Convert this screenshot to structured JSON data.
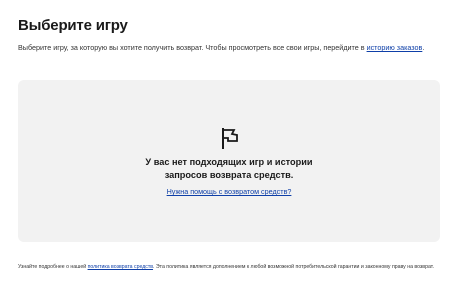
{
  "header": {
    "title": "Выберите игру"
  },
  "intro": {
    "text_before": "Выберите игру, за которую вы хотите получить возврат. Чтобы просмотреть все свои игры, перейдите в ",
    "link_text": "историю заказов",
    "text_after": "."
  },
  "empty_state": {
    "icon": "flag-icon",
    "line1": "У вас нет подходящих игр и истории",
    "line2": "запросов возврата средств.",
    "help_link": "Нужна помощь с возвратом средств?"
  },
  "footer": {
    "text_before": "Узнайте подробнее о нашей ",
    "link_text": "политика возврата средств",
    "text_after": ". Эта политика является дополнением к любой возможной потребительской гарантии и законному праву на возврат."
  },
  "colors": {
    "link": "#0e3fa8",
    "panel_background": "#f2f2f2",
    "text": "#1a1a1a"
  }
}
